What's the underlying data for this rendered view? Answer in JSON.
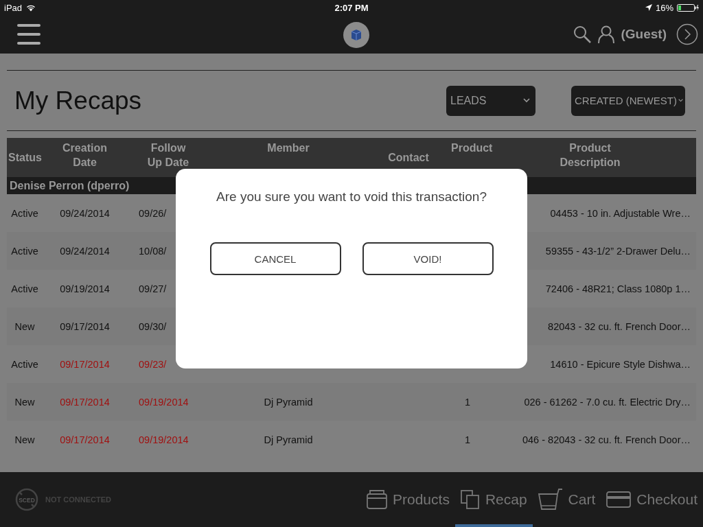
{
  "status_bar": {
    "device": "iPad",
    "time": "2:07 PM",
    "battery": "16%"
  },
  "app_bar": {
    "user": "(Guest)"
  },
  "page": {
    "title": "My Recaps",
    "filters": [
      {
        "label": "LEADS"
      },
      {
        "label": "CREATED (NEWEST)"
      }
    ]
  },
  "table": {
    "columns": [
      "Status",
      "Creation Date",
      "Follow Up Date",
      "Member",
      "Contact",
      "Product",
      "Product Description"
    ],
    "group": "Denise Perron (dperro)",
    "rows": [
      {
        "status": "Active",
        "created": "09/24/2014",
        "follow_up": "09/26/",
        "description": "04453 - 10 in. Adjustable Wre…",
        "overdue": false
      },
      {
        "status": "Active",
        "created": "09/24/2014",
        "follow_up": "10/08/",
        "description": "59355 - 43-1/2” 2-Drawer Delu…",
        "overdue": false
      },
      {
        "status": "Active",
        "created": "09/19/2014",
        "follow_up": "09/27/",
        "description": "72406 - 48R21; Class 1080p 1…",
        "overdue": false
      },
      {
        "status": "New",
        "created": "09/17/2014",
        "follow_up": "09/30/",
        "description": "82043 - 32 cu. ft. French Door…",
        "overdue": false
      },
      {
        "status": "Active",
        "created": "09/17/2014",
        "follow_up": "09/23/",
        "description": "14610 - Epicure Style Dishwa…",
        "overdue": true
      },
      {
        "status": "New",
        "created": "09/17/2014",
        "follow_up": "09/19/2014",
        "member": "Dj Pyramid",
        "product": "1",
        "description": "026 - 61262 - 7.0 cu. ft. Electric Dry…",
        "overdue": true
      },
      {
        "status": "New",
        "created": "09/17/2014",
        "follow_up": "09/19/2014",
        "member": "Dj Pyramid",
        "product": "1",
        "description": "046 - 82043 - 32 cu. ft. French Door…",
        "overdue": true
      }
    ]
  },
  "dialog": {
    "message": "Are you sure you want to void this transaction?",
    "buttons": [
      {
        "label": "CANCEL"
      },
      {
        "label": "VOID!"
      }
    ]
  },
  "footer": {
    "connection_badge": "SCED",
    "connection": "NOT CONNECTED",
    "tabs": [
      {
        "label": "Products",
        "kind": "products",
        "selected": false
      },
      {
        "label": "Recap",
        "kind": "recap",
        "selected": true
      },
      {
        "label": "Cart",
        "kind": "cart",
        "selected": false
      },
      {
        "label": "Checkout",
        "kind": "checkout",
        "selected": false
      }
    ]
  }
}
